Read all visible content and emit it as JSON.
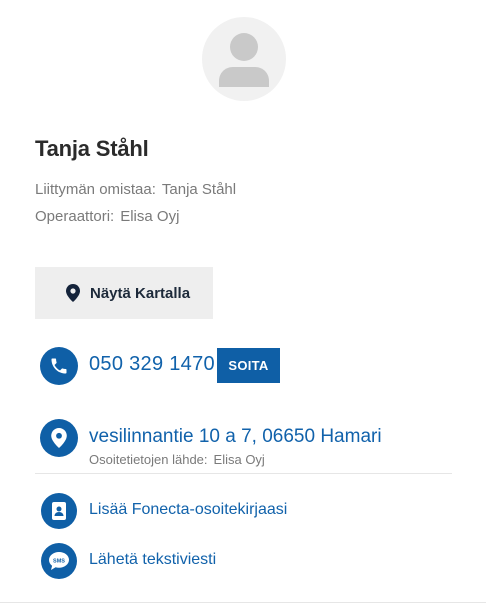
{
  "contact": {
    "name": "Tanja Ståhl",
    "owner_label": "Liittymän omistaa:",
    "owner_value": "Tanja Ståhl",
    "operator_label": "Operaattori:",
    "operator_value": "Elisa Oyj"
  },
  "map_button": {
    "label": "Näytä Kartalla",
    "icon": "map-pin-icon"
  },
  "phone": {
    "number": "050 329 1470",
    "call_label": "SOITA",
    "icon": "phone-icon"
  },
  "address": {
    "text": "vesilinnantie 10 a 7, 06650 Hamari",
    "source_label": "Osoitetietojen lähde:",
    "source_value": "Elisa Oyj",
    "icon": "location-icon"
  },
  "actions": [
    {
      "label": "Lisää Fonecta-osoitekirjaasi",
      "icon": "address-book-icon"
    },
    {
      "label": "Lähetä tekstiviesti",
      "icon": "sms-icon",
      "icon_text": "SMS"
    }
  ],
  "colors": {
    "primary": "#0f5fa6",
    "link": "#1162ab",
    "muted": "#7a7a7a",
    "button_bg": "#eeeeee"
  }
}
